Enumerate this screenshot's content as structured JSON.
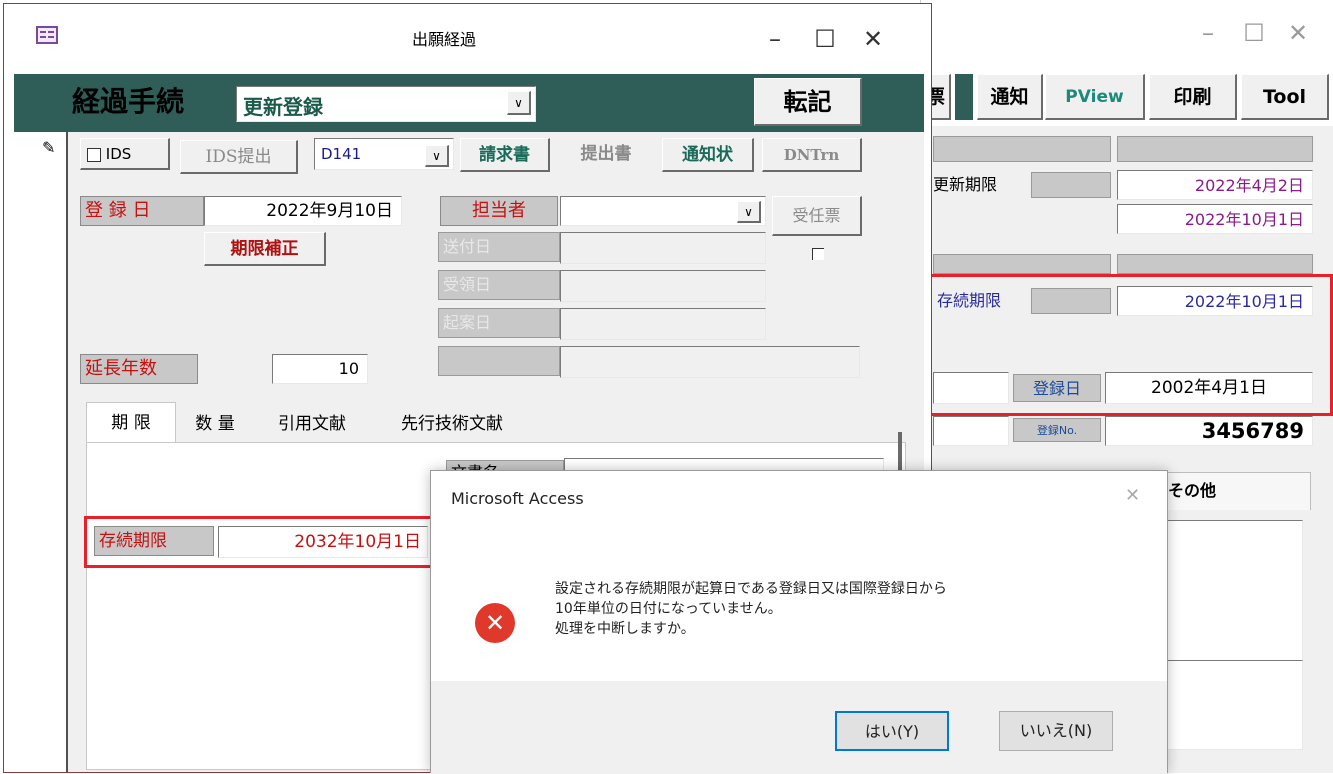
{
  "background_window": {
    "toolbar": {
      "partial_tab": "票",
      "notice": "通知",
      "pview": "PView",
      "print": "印刷",
      "tool": "Tool"
    },
    "renewal_deadline_label": "更新期限",
    "renewal_deadline_value": "2022年4月2日",
    "renewal_deadline_value2": "2022年10月1日",
    "duration_label": "存続期限",
    "duration_value": "2022年10月1日",
    "registration_date_label": "登録日",
    "registration_date_value": "2002年4月1日",
    "registration_no_label": "登録No.",
    "registration_no_value": "3456789",
    "other_tab": "その他"
  },
  "main_window": {
    "title": "出願経過",
    "header": {
      "procedure_label": "経過手続",
      "procedure_value": "更新登録",
      "transcribe_button": "転記"
    },
    "row1": {
      "ids_checkbox_label": "IDS",
      "ids_submit": "IDS提出",
      "code": "D141",
      "invoice": "請求書",
      "submission": "提出書",
      "notice": "通知状",
      "dntrn": "DNTrn"
    },
    "registration_date_label": "登 録 日",
    "registration_date_value": "2022年9月10日",
    "deadline_correction": "期限補正",
    "person_in_charge_label": "担当者",
    "acceptance_slip": "受任票",
    "sent_date_label": "送付日",
    "received_date_label": "受領日",
    "draft_date_label": "起案日",
    "extension_years_label": "延長年数",
    "extension_years_value": "10",
    "tabs": [
      "期 限",
      "数 量",
      "引用文献",
      "先行技術文献"
    ],
    "doc_name_label": "文書名",
    "duration_label": "存続期限",
    "duration_value": "2032年10月1日"
  },
  "dialog": {
    "title": "Microsoft Access",
    "message_lines": [
      "設定される存続期限が起算日である登録日又は国際登録日から",
      "10年単位の日付になっていません。",
      "処理を中断しますか。"
    ],
    "yes_button": "はい(Y)",
    "no_button": "いいえ(N)"
  },
  "colors": {
    "header_bg": "#2f5e58",
    "highlight_red": "#e8202a",
    "label_red": "#c81010",
    "date_purple": "#8a1a8a"
  }
}
